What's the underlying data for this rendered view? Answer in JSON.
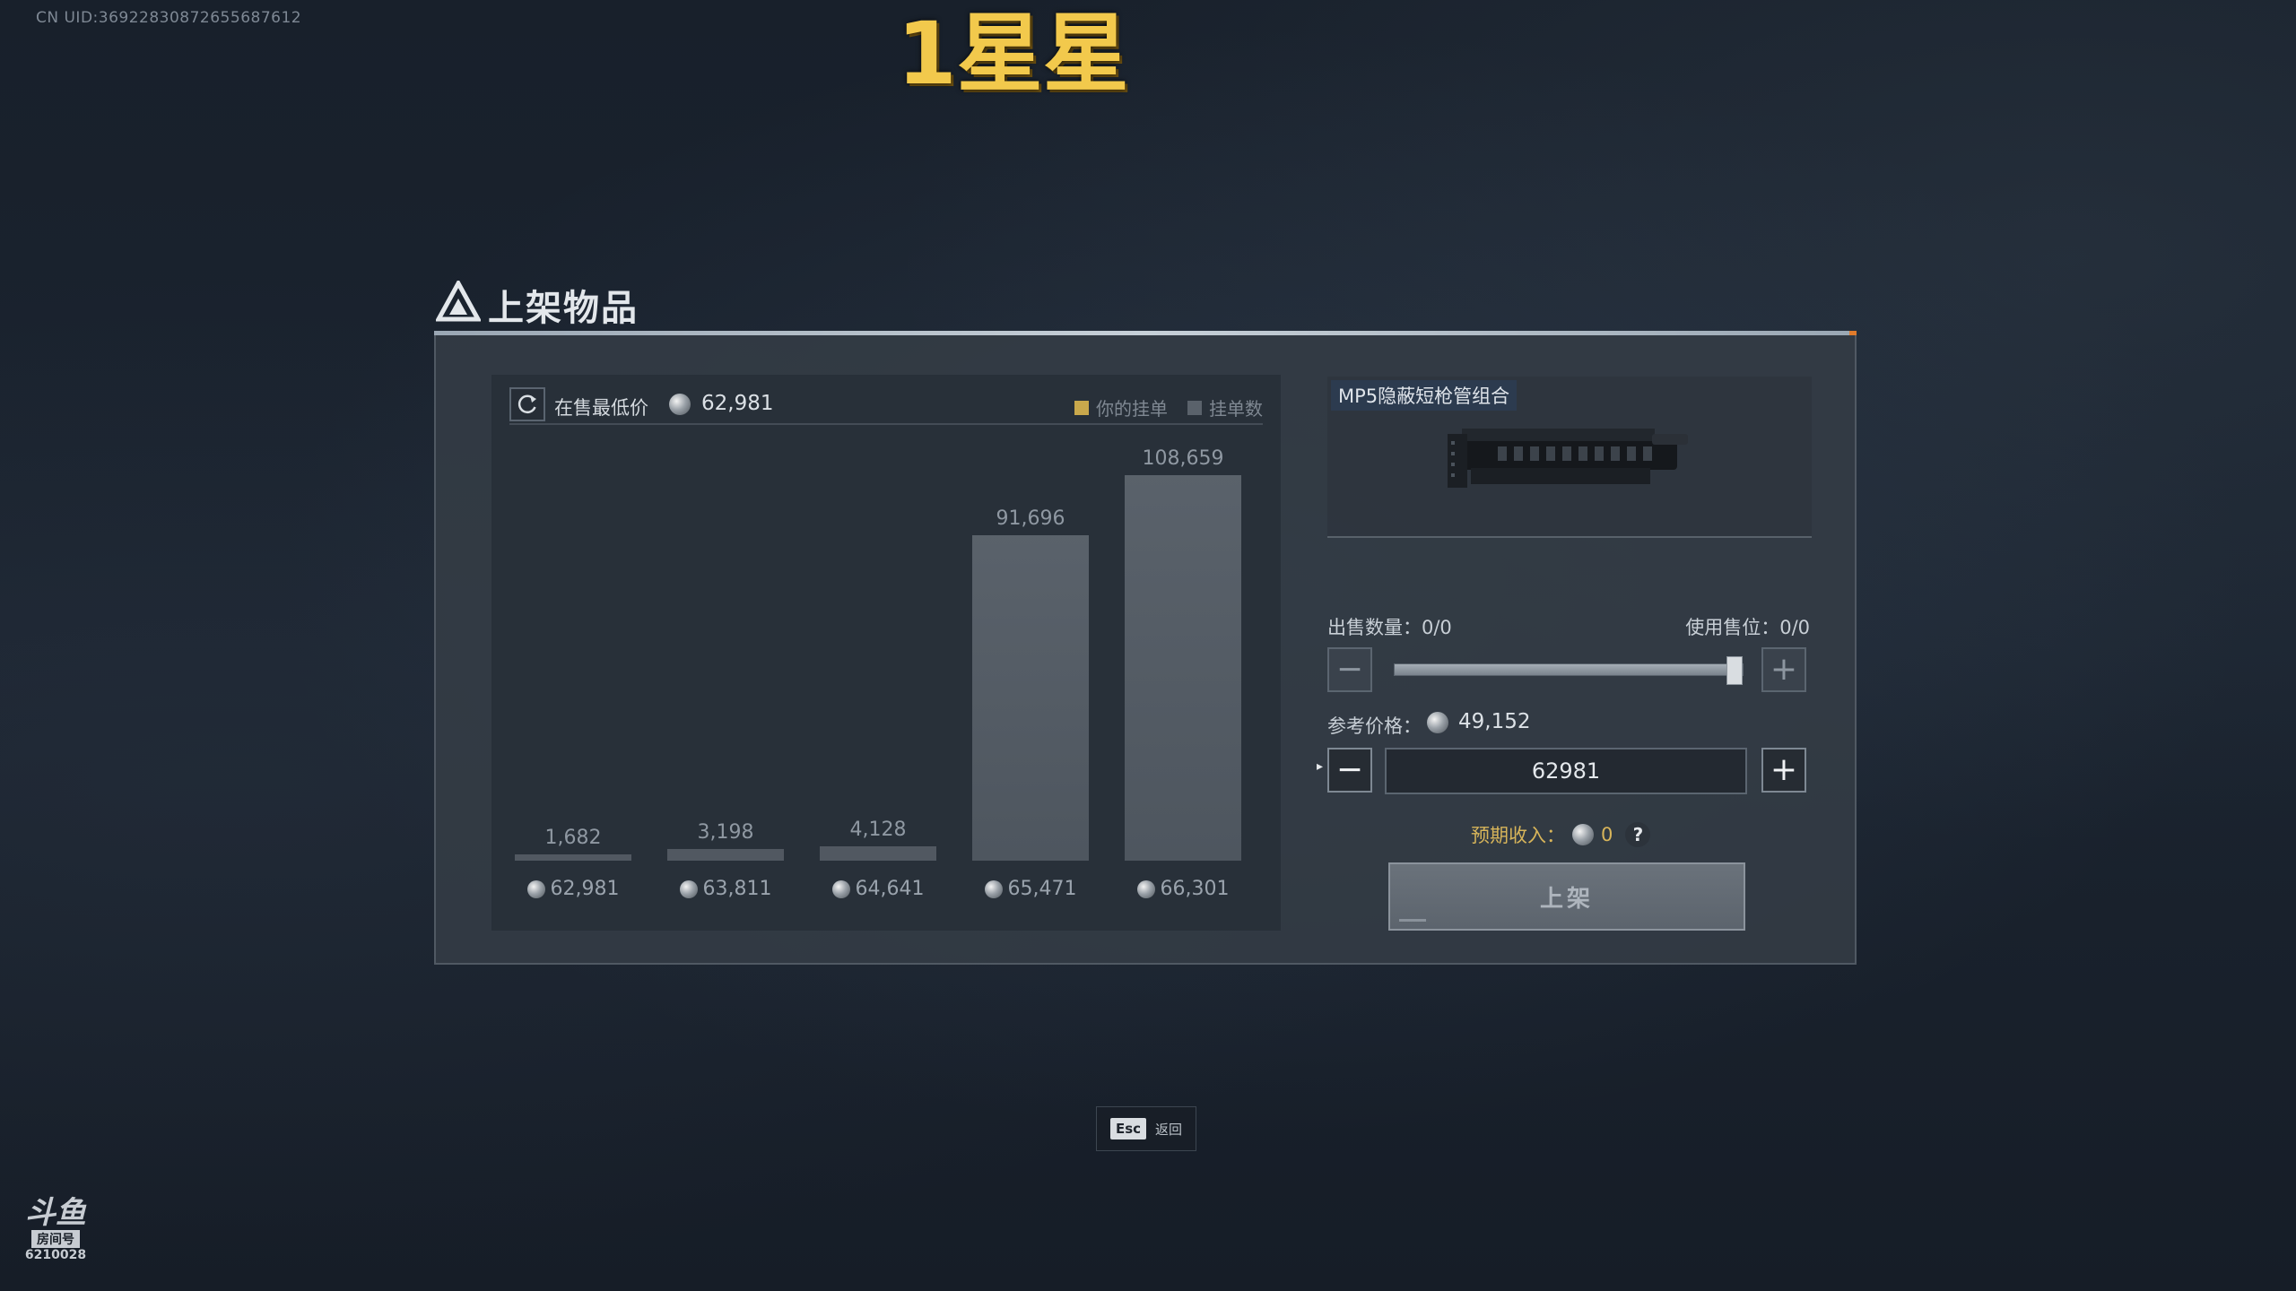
{
  "overlay": {
    "uid": "CN UID:369228308726556876​12",
    "stream_title": "1星星"
  },
  "dialog": {
    "title": "上架物品"
  },
  "market": {
    "lowest_label": "在售最低价",
    "lowest_value": "62,981",
    "legend": [
      "你的挂单",
      "挂单数"
    ],
    "colors": {
      "your_order": "#c9a84c",
      "order_count": "#5a626b"
    }
  },
  "chart_data": {
    "type": "bar",
    "categories": [
      "62,981",
      "63,811",
      "64,641",
      "65,471",
      "66,301"
    ],
    "values": [
      1682,
      3198,
      4128,
      91696,
      108659
    ],
    "value_labels": [
      "1,682",
      "3,198",
      "4,128",
      "91,696",
      "108,659"
    ],
    "xlabel": "",
    "ylabel": "",
    "ylim": [
      0,
      108659
    ],
    "legend_placement": "top-right"
  },
  "item": {
    "name": "MP5隐蔽短枪管组合"
  },
  "sell": {
    "qty_label": "出售数量：0/0",
    "slot_label": "使用售位：0/0",
    "slider_fraction": 1.0,
    "ref_label": "参考价格：",
    "ref_value": "49,152",
    "price_input_value": "62981",
    "income_label": "预期收入：",
    "income_value": "0",
    "help_glyph": "?",
    "list_button": "上架"
  },
  "footer": {
    "esc_key": "Esc",
    "esc_label": "返回"
  },
  "watermark": {
    "logo": "斗鱼",
    "sub": "房间号",
    "room": "6210028"
  }
}
